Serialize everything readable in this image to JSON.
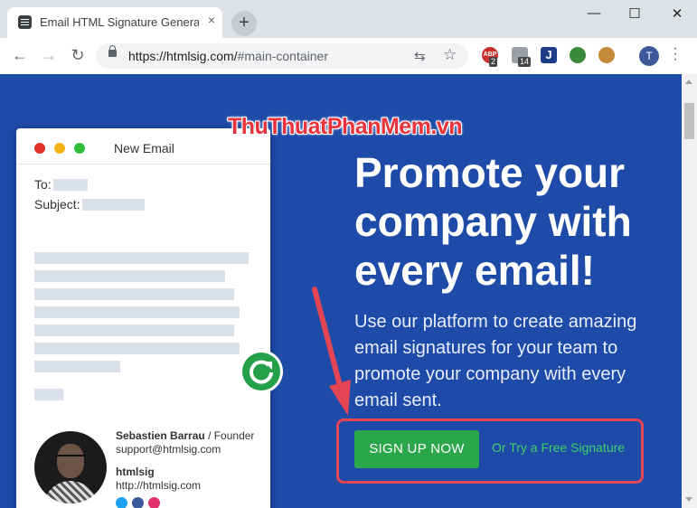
{
  "browser": {
    "tab_title": "Email HTML Signature Generator",
    "tab_close": "×",
    "new_tab": "+",
    "url_host": "https://htmlsig.com/",
    "url_path": "#main-container",
    "ext_abp": "ABP",
    "ext_abp_count": "2",
    "ext_shield_count": "14",
    "ext_j": "J",
    "profile_initial": "T",
    "win_min": "—",
    "win_max": "☐",
    "win_close": "✕"
  },
  "watermark": "ThuThuatPhanMem.vn",
  "email_card": {
    "title": "New Email",
    "to_label": "To:",
    "subject_label": "Subject:",
    "sig_name": "Sebastien Barrau",
    "sig_role": "/ Founder",
    "sig_email": "support@htmlsig.com",
    "sig_company": "htmlsig",
    "sig_site": "http://htmlsig.com"
  },
  "hero": {
    "headline_1": "Promote your",
    "headline_2": "company with",
    "headline_3": "every email!",
    "subtext": "Use our platform to create amazing email signatures for your team to promote your company with every email sent.",
    "cta_label": "SIGN UP NOW",
    "alt_link": "Or Try a Free Signature"
  },
  "colors": {
    "page_bg": "#1e4aa8",
    "cta": "#2ca64a",
    "alt_link": "#3fd06a",
    "highlight": "#e34554"
  }
}
